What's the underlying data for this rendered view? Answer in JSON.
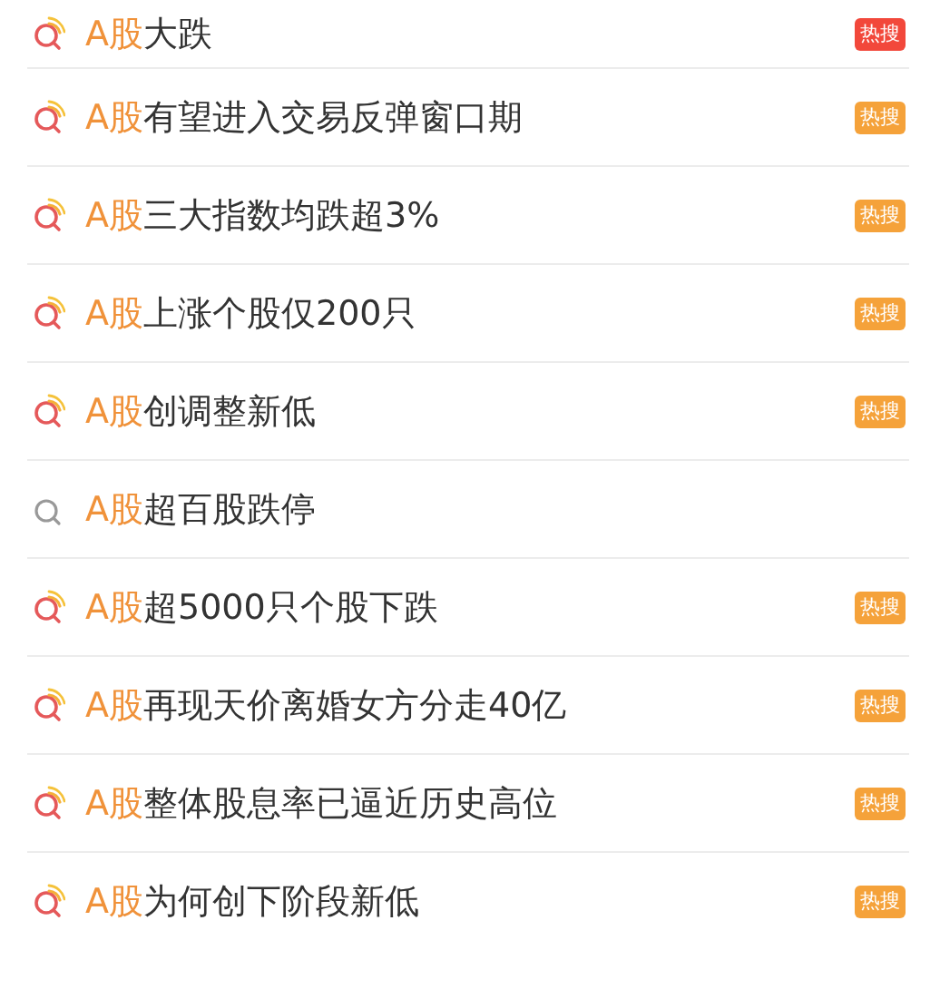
{
  "results": [
    {
      "kind": "hot",
      "keyword": "A股",
      "rest": "大跌",
      "badge": {
        "label": "热搜",
        "color": "#f2483b"
      }
    },
    {
      "kind": "hot",
      "keyword": "A股",
      "rest": "有望进入交易反弹窗口期",
      "badge": {
        "label": "热搜",
        "color": "#f5a23a"
      }
    },
    {
      "kind": "hot",
      "keyword": "A股",
      "rest": "三大指数均跌超3%",
      "badge": {
        "label": "热搜",
        "color": "#f5a23a"
      }
    },
    {
      "kind": "hot",
      "keyword": "A股",
      "rest": "上涨个股仅200只",
      "badge": {
        "label": "热搜",
        "color": "#f5a23a"
      }
    },
    {
      "kind": "hot",
      "keyword": "A股",
      "rest": "创调整新低",
      "badge": {
        "label": "热搜",
        "color": "#f5a23a"
      }
    },
    {
      "kind": "plain",
      "keyword": "A股",
      "rest": "超百股跌停"
    },
    {
      "kind": "hot",
      "keyword": "A股",
      "rest": "超5000只个股下跌",
      "badge": {
        "label": "热搜",
        "color": "#f5a23a"
      }
    },
    {
      "kind": "hot",
      "keyword": "A股",
      "rest": "再现天价离婚女方分走40亿",
      "badge": {
        "label": "热搜",
        "color": "#f5a23a"
      }
    },
    {
      "kind": "hot",
      "keyword": "A股",
      "rest": "整体股息率已逼近历史高位",
      "badge": {
        "label": "热搜",
        "color": "#f5a23a"
      }
    },
    {
      "kind": "hot",
      "keyword": "A股",
      "rest": "为何创下阶段新低",
      "badge": {
        "label": "热搜",
        "color": "#f5a23a"
      }
    }
  ]
}
